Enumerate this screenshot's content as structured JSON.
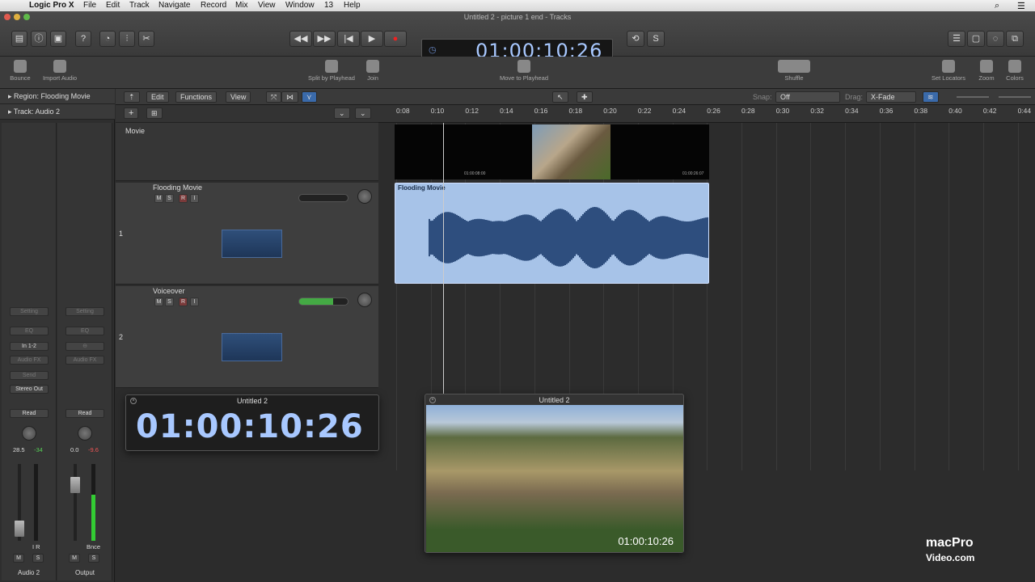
{
  "menubar": {
    "app": "Logic Pro X",
    "items": [
      "File",
      "Edit",
      "Track",
      "Navigate",
      "Record",
      "Mix",
      "View",
      "Window",
      "13",
      "Help"
    ]
  },
  "window": {
    "title": "Untitled 2 - picture 1 end - Tracks"
  },
  "transport": {
    "time": "01:00:10:26"
  },
  "toolbar": {
    "bounce": "Bounce",
    "import_audio": "Import Audio",
    "split": "Split by Playhead",
    "join": "Join",
    "move_to_playhead": "Move to Playhead",
    "shuffle": "Shuffle",
    "set_locators": "Set Locators",
    "zoom": "Zoom",
    "colors": "Colors"
  },
  "inspector": {
    "region": "Region: Flooding Movie",
    "track": "Track:  Audio 2",
    "strip1": {
      "setting": "Setting",
      "eq": "EQ",
      "input": "In 1-2",
      "audiofx": "Audio FX",
      "send": "Send",
      "output": "Stereo Out",
      "mode": "Read",
      "vol": "28.5",
      "peak": "-34",
      "m": "M",
      "s": "S",
      "name": "Audio 2",
      "ir": "I  R"
    },
    "strip2": {
      "setting": "Setting",
      "eq": "EQ",
      "audiofx": "Audio FX",
      "mode": "Read",
      "vol": "0.0",
      "peak": "-9.6",
      "m": "M",
      "s": "S",
      "name": "Output",
      "bnce": "Bnce"
    }
  },
  "localbar": {
    "edit": "Edit",
    "functions": "Functions",
    "view": "View",
    "snap_label": "Snap:",
    "snap_value": "Off",
    "drag_label": "Drag:",
    "drag_value": "X-Fade"
  },
  "ruler": [
    "0:08",
    "0:10",
    "0:12",
    "0:14",
    "0:16",
    "0:18",
    "0:20",
    "0:22",
    "0:24",
    "0:26",
    "0:28",
    "0:30",
    "0:32",
    "0:34",
    "0:36",
    "0:38",
    "0:40",
    "0:42",
    "0:44"
  ],
  "movie_track": {
    "label": "Movie",
    "tc1": "01:00:08:00",
    "tc2": "01:00:26:07"
  },
  "tracks": [
    {
      "num": "1",
      "name": "Flooding Movie",
      "m": "M",
      "s": "S",
      "r": "R",
      "i": "I"
    },
    {
      "num": "2",
      "name": "Voiceover",
      "m": "M",
      "s": "S",
      "r": "R",
      "i": "I"
    }
  ],
  "region": {
    "name": "Flooding Movie"
  },
  "timecode_window": {
    "title": "Untitled 2",
    "time": "01:00:10:26"
  },
  "movie_window": {
    "title": "Untitled 2",
    "time": "01:00:10:26"
  },
  "logo": {
    "line1": "macPro",
    "line2": "Video.com"
  }
}
